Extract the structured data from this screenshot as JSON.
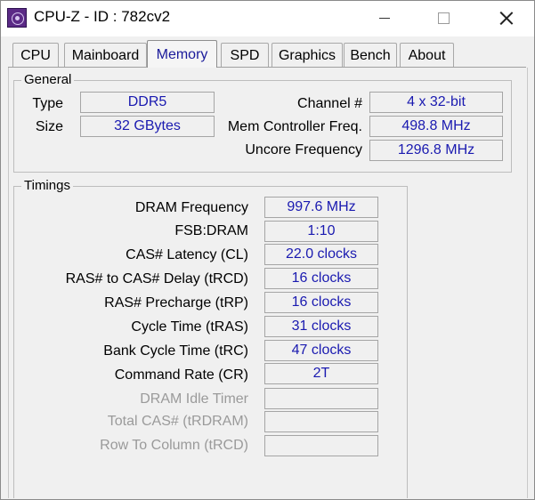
{
  "window": {
    "title": "CPU-Z - ID : 782cv2"
  },
  "tabs": [
    {
      "label": "CPU"
    },
    {
      "label": "Mainboard"
    },
    {
      "label": "Memory",
      "active": true
    },
    {
      "label": "SPD"
    },
    {
      "label": "Graphics"
    },
    {
      "label": "Bench"
    },
    {
      "label": "About"
    }
  ],
  "general": {
    "legend": "General",
    "type_label": "Type",
    "type_value": "DDR5",
    "size_label": "Size",
    "size_value": "32 GBytes",
    "channel_label": "Channel #",
    "channel_value": "4 x 32-bit",
    "mc_freq_label": "Mem Controller Freq.",
    "mc_freq_value": "498.8 MHz",
    "uncore_label": "Uncore Frequency",
    "uncore_value": "1296.8 MHz"
  },
  "timings": {
    "legend": "Timings",
    "rows": [
      {
        "label": "DRAM Frequency",
        "value": "997.6 MHz",
        "enabled": true
      },
      {
        "label": "FSB:DRAM",
        "value": "1:10",
        "enabled": true
      },
      {
        "label": "CAS# Latency (CL)",
        "value": "22.0 clocks",
        "enabled": true
      },
      {
        "label": "RAS# to CAS# Delay (tRCD)",
        "value": "16 clocks",
        "enabled": true
      },
      {
        "label": "RAS# Precharge (tRP)",
        "value": "16 clocks",
        "enabled": true
      },
      {
        "label": "Cycle Time (tRAS)",
        "value": "31 clocks",
        "enabled": true
      },
      {
        "label": "Bank Cycle Time (tRC)",
        "value": "47 clocks",
        "enabled": true
      },
      {
        "label": "Command Rate (CR)",
        "value": "2T",
        "enabled": true
      },
      {
        "label": "DRAM Idle Timer",
        "value": "",
        "enabled": false
      },
      {
        "label": "Total CAS# (tRDRAM)",
        "value": "",
        "enabled": false
      },
      {
        "label": "Row To Column (tRCD)",
        "value": "",
        "enabled": false
      }
    ]
  }
}
